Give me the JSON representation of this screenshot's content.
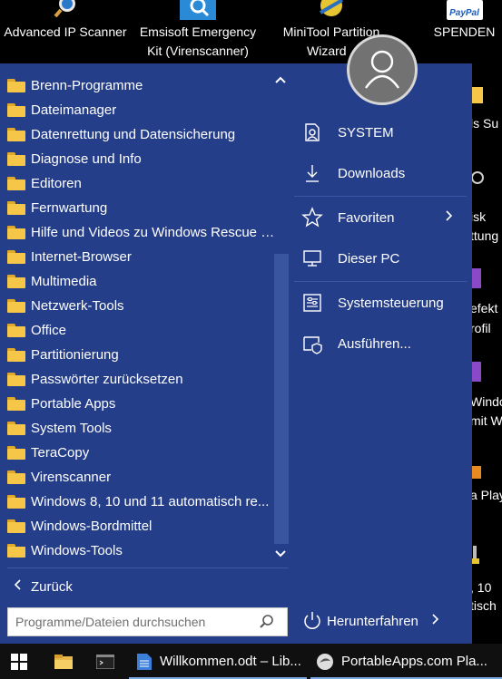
{
  "desktop": {
    "top_icons": [
      {
        "label1": "Advanced IP Scanner",
        "label2": ""
      },
      {
        "label1": "Emsisoft Emergency",
        "label2": "Kit (Virenscanner)"
      },
      {
        "label1": "MiniTool Partition",
        "label2": "Wizard"
      },
      {
        "label1": "SPENDEN",
        "label2": ""
      }
    ],
    "paypal_text": "PayPal",
    "right_fragments": [
      "ls Su",
      "isk",
      "ttung",
      "efekt",
      "rofil",
      "Windo",
      "mit W",
      "a Play",
      ", 10",
      "tisch"
    ]
  },
  "start_menu": {
    "folders": [
      "Brenn-Programme",
      "Dateimanager",
      "Datenrettung und Datensicherung",
      "Diagnose und Info",
      "Editoren",
      "Fernwartung",
      "Hilfe und Videos zu Windows Rescue Li...",
      "Internet-Browser",
      "Multimedia",
      "Netzwerk-Tools",
      "Office",
      "Partitionierung",
      "Passwörter zurücksetzen",
      "Portable Apps",
      "System Tools",
      "TeraCopy",
      "Virenscanner",
      "Windows 8, 10  und 11 automatisch re...",
      "Windows-Bordmittel",
      "Windows-Tools"
    ],
    "back_label": "Zurück",
    "search_placeholder": "Programme/Dateien durchsuchen",
    "right_items": [
      {
        "label": "SYSTEM",
        "icon": "user-doc-icon"
      },
      {
        "label": "Downloads",
        "icon": "download-icon"
      },
      {
        "label": "Favoriten",
        "icon": "star-icon"
      },
      {
        "label": "Dieser PC",
        "icon": "monitor-icon"
      },
      {
        "label": "Systemsteuerung",
        "icon": "control-panel-icon"
      },
      {
        "label": "Ausführen...",
        "icon": "run-icon"
      }
    ],
    "shutdown_label": "Herunterfahren"
  },
  "taskbar": {
    "items": [
      {
        "label": "Willkommen.odt – Lib..."
      },
      {
        "label": "PortableApps.com Pla..."
      }
    ]
  },
  "colors": {
    "menu_bg": "#253e8a",
    "taskbar_bg": "#101010",
    "folder": "#f5c648"
  }
}
